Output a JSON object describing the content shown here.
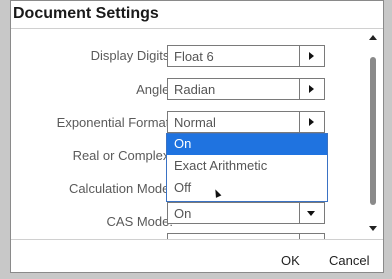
{
  "dialog": {
    "title": "Document Settings"
  },
  "settings": [
    {
      "label": "Display Digits:",
      "value": "Float 6"
    },
    {
      "label": "Angle:",
      "value": "Radian"
    },
    {
      "label": "Exponential Format:",
      "value": "Normal"
    },
    {
      "label": "Real or Complex:",
      "value": ""
    },
    {
      "label": "Calculation Mode:",
      "value": ""
    },
    {
      "label": "CAS Mode:",
      "value": "On"
    }
  ],
  "dropdown": {
    "options": [
      "On",
      "Exact Arithmetic",
      "Off"
    ],
    "selected_index": 0
  },
  "footer": {
    "ok_label": "OK",
    "cancel_label": "Cancel"
  },
  "colors": {
    "selection": "#1f73e0",
    "dropdown_border": "#3a72c4"
  }
}
